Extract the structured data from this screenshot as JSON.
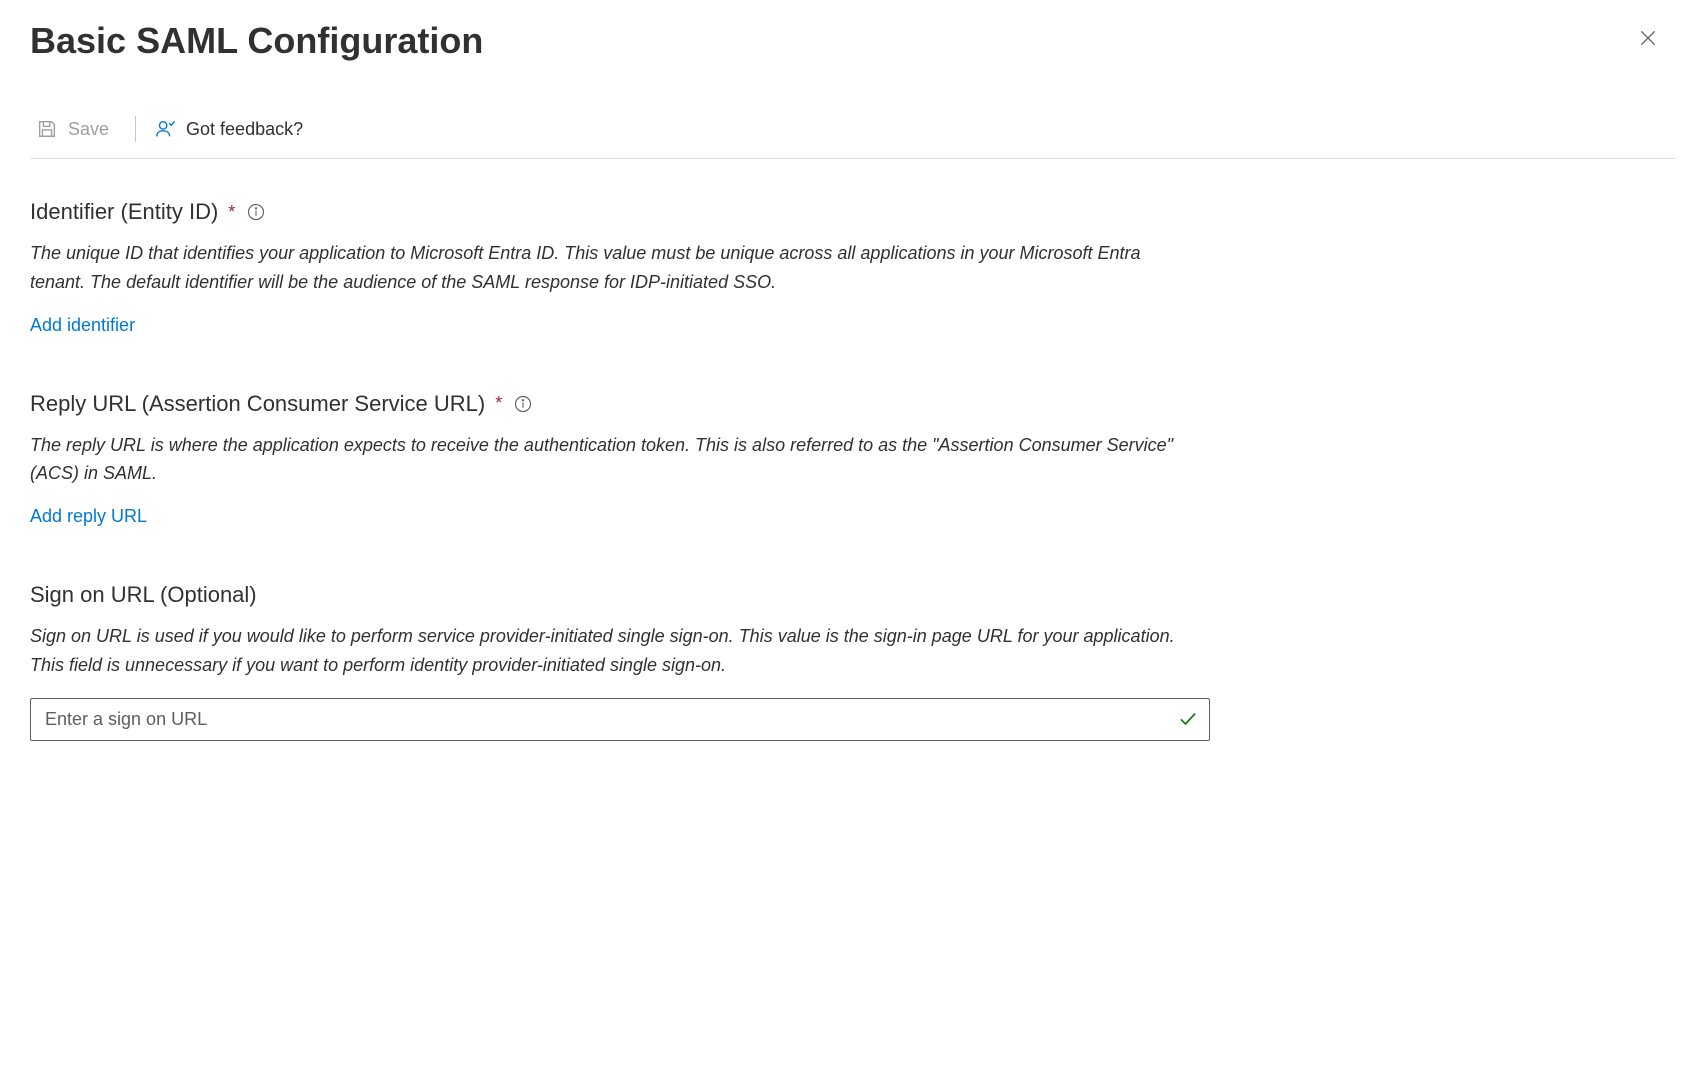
{
  "header": {
    "title": "Basic SAML Configuration"
  },
  "toolbar": {
    "save_label": "Save",
    "feedback_label": "Got feedback?"
  },
  "sections": {
    "identifier": {
      "title": "Identifier (Entity ID)",
      "required": true,
      "description": "The unique ID that identifies your application to Microsoft Entra ID. This value must be unique across all applications in your Microsoft Entra tenant. The default identifier will be the audience of the SAML response for IDP-initiated SSO.",
      "add_link": "Add identifier"
    },
    "reply_url": {
      "title": "Reply URL (Assertion Consumer Service URL)",
      "required": true,
      "description": "The reply URL is where the application expects to receive the authentication token. This is also referred to as the \"Assertion Consumer Service\" (ACS) in SAML.",
      "add_link": "Add reply URL"
    },
    "sign_on_url": {
      "title": "Sign on URL (Optional)",
      "required": false,
      "description": "Sign on URL is used if you would like to perform service provider-initiated single sign-on. This value is the sign-in page URL for your application. This field is unnecessary if you want to perform identity provider-initiated single sign-on.",
      "placeholder": "Enter a sign on URL",
      "value": ""
    }
  }
}
